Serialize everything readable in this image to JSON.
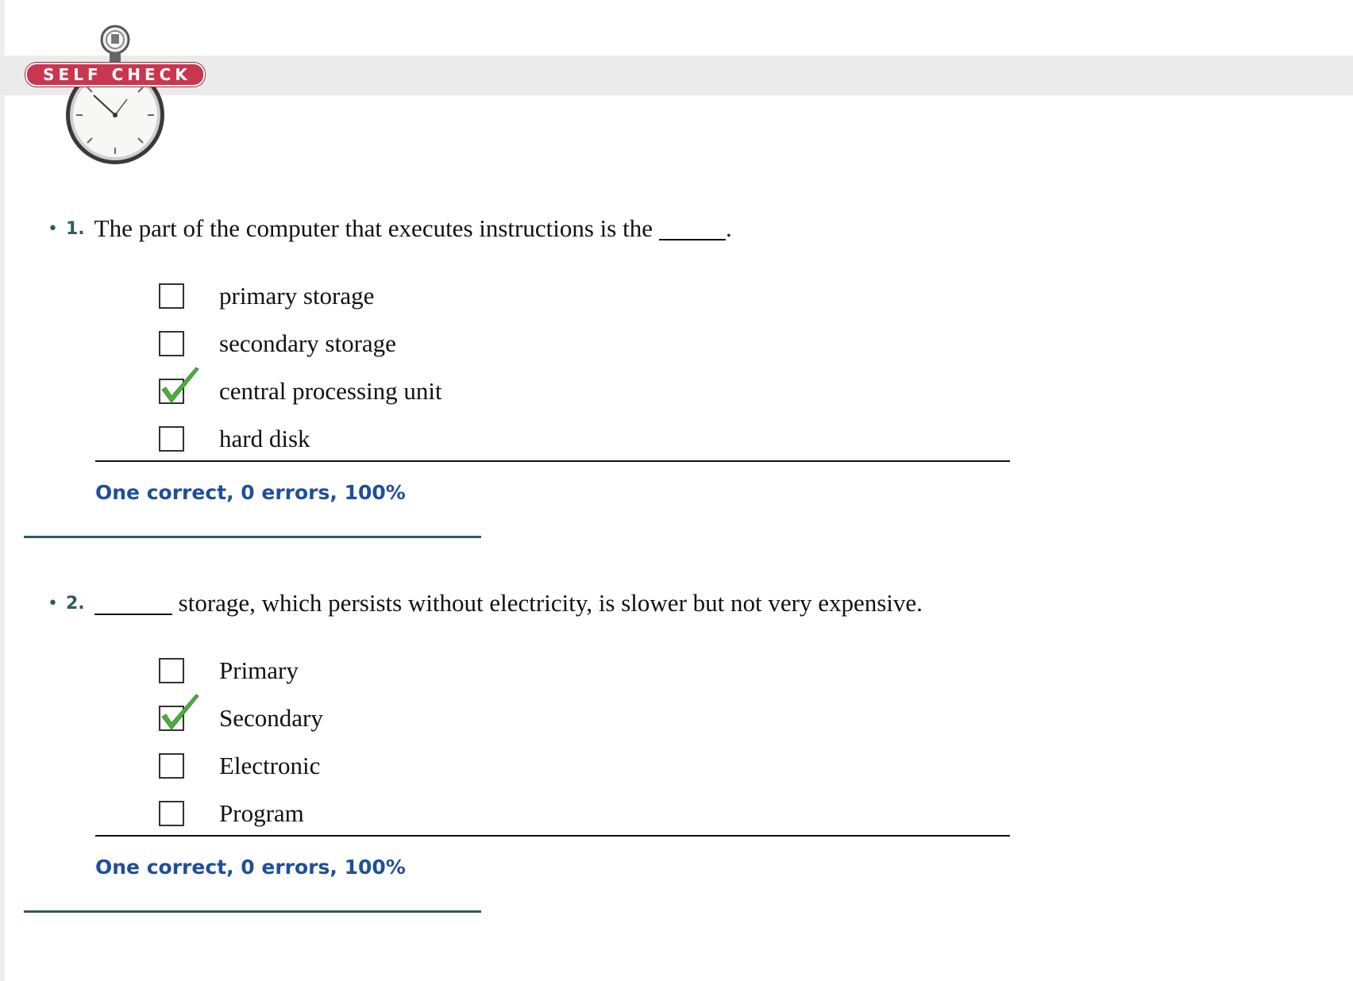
{
  "header": {
    "badge_label": "SELF CHECK"
  },
  "questions": [
    {
      "number": "1.",
      "text_before": "The part of the computer that executes instructions is the",
      "text_after": ".",
      "options": [
        {
          "label": "primary storage",
          "checked": false
        },
        {
          "label": "secondary storage",
          "checked": false
        },
        {
          "label": "central processing unit",
          "checked": true
        },
        {
          "label": "hard disk",
          "checked": false
        }
      ],
      "score": "One correct, 0 errors, 100%"
    },
    {
      "number": "2.",
      "text_before": "",
      "text_after": "storage, which persists without electricity, is slower but not very expensive.",
      "options": [
        {
          "label": "Primary",
          "checked": false
        },
        {
          "label": "Secondary",
          "checked": true
        },
        {
          "label": "Electronic",
          "checked": false
        },
        {
          "label": "Program",
          "checked": false
        }
      ],
      "score": "One correct, 0 errors, 100%"
    }
  ],
  "colors": {
    "accent_teal": "#2d5d5a",
    "score_blue": "#1f4f9a",
    "badge_red": "#c8374f",
    "check_green": "#4caf3f"
  },
  "icons": {
    "badge": "stopwatch-icon",
    "checked": "green-checkmark-icon"
  }
}
